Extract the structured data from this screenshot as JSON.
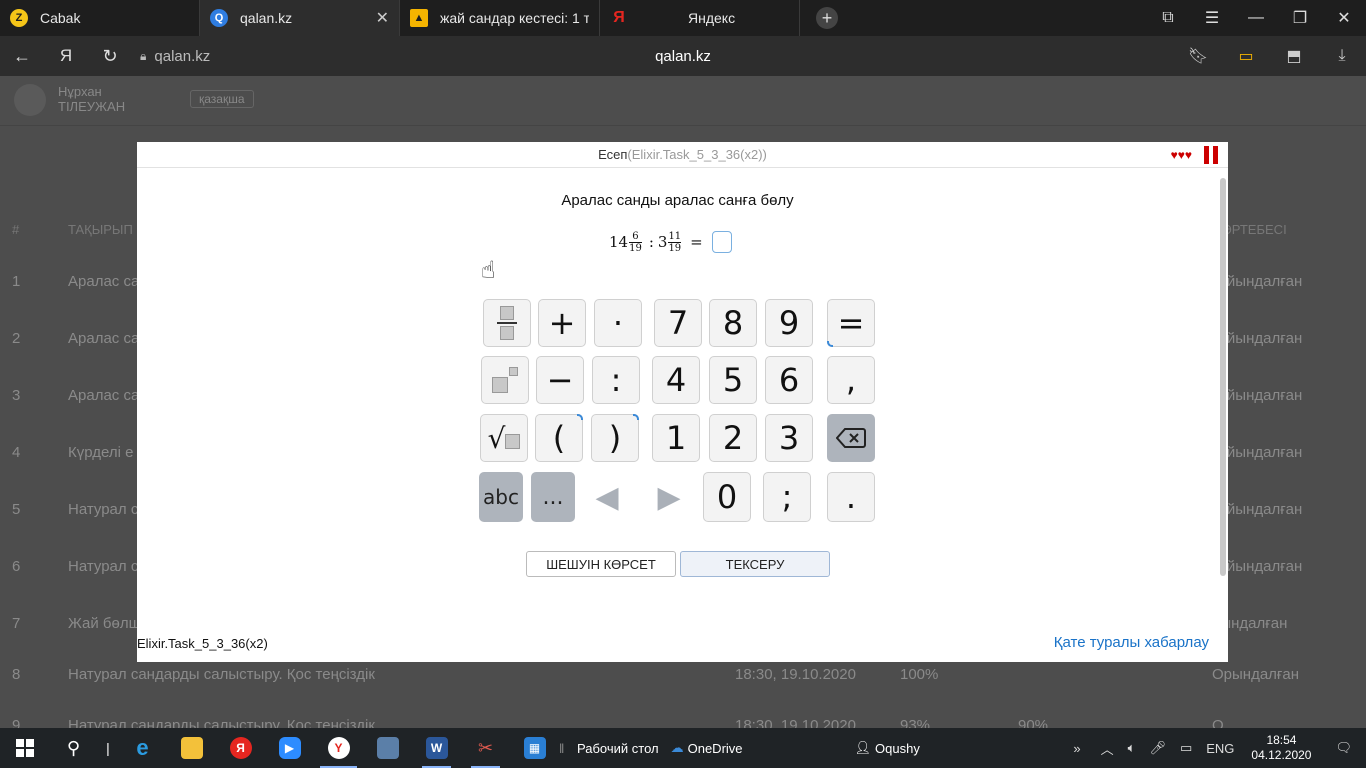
{
  "browser": {
    "tabs": [
      {
        "title": "Cabak",
        "icon": "z-logo",
        "color": "#f5c518",
        "active": false
      },
      {
        "title": "qalan.kz",
        "icon": "qalan-logo",
        "color": "#2f7de1",
        "active": true
      },
      {
        "title": "жай сандар кестесі: 1 тыс",
        "icon": "image-icon",
        "color": "#f5b400",
        "active": false
      },
      {
        "title": "Яндекс",
        "icon": "yandex-icon",
        "color": "#e52620",
        "active": false
      }
    ],
    "address": {
      "host_left": "qalan.kz",
      "title_center": "qalan.kz"
    }
  },
  "background_page": {
    "user_name_line1": "Нұрхан",
    "user_name_line2": "ТІЛЕУЖАН",
    "language": "қазақша",
    "table_headers": {
      "num": "#",
      "topic": "ТАҚЫРЫП",
      "status": "ӘРТЕБЕСІ"
    },
    "rows": [
      {
        "n": "1",
        "topic": "Аралас са",
        "date": "",
        "pct": "",
        "pct2": "",
        "status": "қайындалған"
      },
      {
        "n": "2",
        "topic": "Аралас са",
        "date": "",
        "pct": "",
        "pct2": "",
        "status": "қайындалған"
      },
      {
        "n": "3",
        "topic": "Аралас са",
        "date": "",
        "pct": "",
        "pct2": "",
        "status": "қайындалған"
      },
      {
        "n": "4",
        "topic": "Күрделі е",
        "date": "",
        "pct": "",
        "pct2": "",
        "status": "қайындалған"
      },
      {
        "n": "5",
        "topic": "Натурал с",
        "date": "",
        "pct": "",
        "pct2": "",
        "status": "қайындалған"
      },
      {
        "n": "6",
        "topic": "Натурал с",
        "date": "",
        "pct": "",
        "pct2": "",
        "status": "қайындалған"
      },
      {
        "n": "7",
        "topic": "Жай бөлш",
        "date": "",
        "pct": "",
        "pct2": "",
        "status": "рындалған"
      },
      {
        "n": "8",
        "topic": "Натурал сандарды салыстыру. Қос теңсіздік",
        "date": "18:30, 19.10.2020",
        "pct": "100%",
        "pct2": "",
        "status": "Орындалған"
      },
      {
        "n": "9",
        "topic": "Натурал сандарды салыстыру. Қос теңсіздік",
        "date": "18:30, 19.10.2020",
        "pct": "93%",
        "pct2": "90%",
        "status": "О"
      }
    ]
  },
  "modal": {
    "header_label": "Есеп",
    "header_code": "(Elixir.Task_5_3_36(x2))",
    "hearts": "♥♥♥",
    "task_title": "Аралас санды аралас санға бөлу",
    "formula": {
      "whole1": "14",
      "num1": "6",
      "den1": "19",
      "op": ":",
      "whole2": "3",
      "num2": "11",
      "den2": "19",
      "eq": "="
    },
    "keypad": {
      "plus": "+",
      "dot_mul": "·",
      "seven": "7",
      "eight": "8",
      "nine": "9",
      "equals": "=",
      "minus": "−",
      "colon": ":",
      "four": "4",
      "five": "5",
      "six": "6",
      "comma": ",",
      "sqrt": "√",
      "lparen": "(",
      "rparen": ")",
      "one": "1",
      "two": "2",
      "three": "3",
      "abc": "abc",
      "more": "...",
      "zero": "0",
      "semicolon": ";",
      "period": "."
    },
    "show_solution": "ШЕШУІН КӨРСЕТ",
    "check": "ТЕКСЕРУ",
    "footer_code": "Elixir.Task_5_3_36(x2)",
    "report_error": "Қате туралы хабарлау"
  },
  "taskbar": {
    "desktop_label": "Рабочий стол",
    "onedrive_label": "OneDrive",
    "oqushy_label": "Oqushy",
    "language": "ENG",
    "time": "18:54",
    "date": "04.12.2020"
  }
}
